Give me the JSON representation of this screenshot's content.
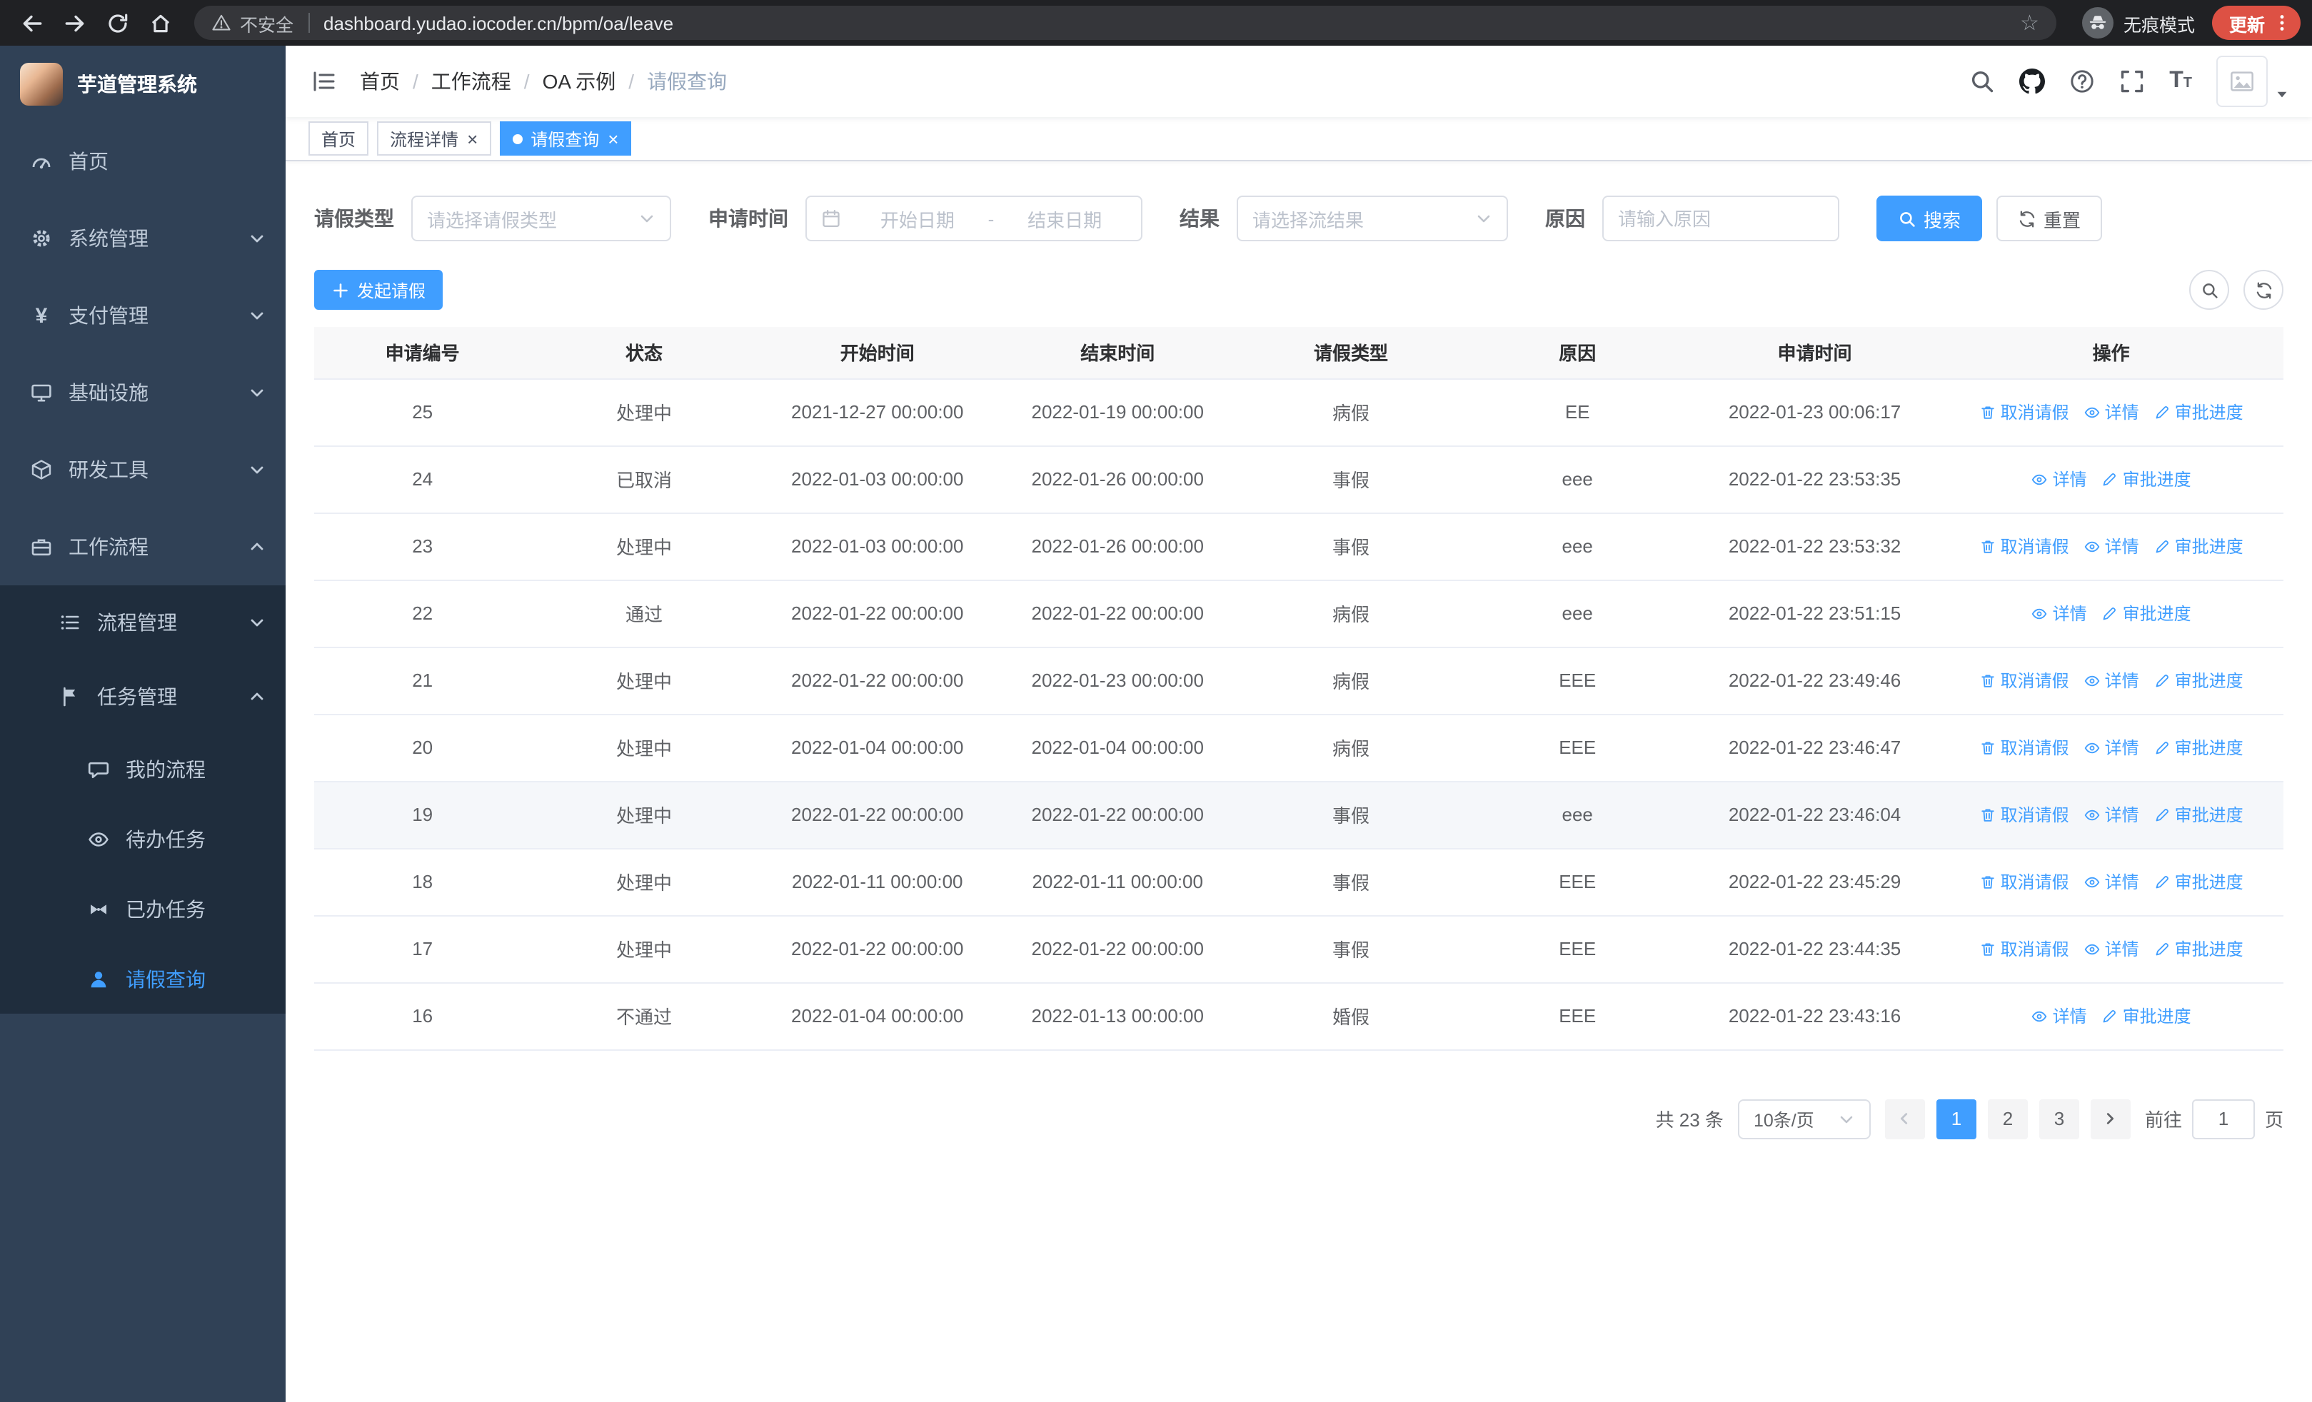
{
  "browser": {
    "security_warning": "不安全",
    "url": "dashboard.yudao.iocoder.cn/bpm/oa/leave",
    "incognito_label": "无痕模式",
    "update_button": "更新"
  },
  "sidebar": {
    "logo_title": "芋道管理系统",
    "top_items": [
      "首页",
      "系统管理",
      "支付管理",
      "基础设施",
      "研发工具",
      "工作流程"
    ],
    "workflow_children": [
      "流程管理",
      "任务管理"
    ],
    "task_children": [
      "我的流程",
      "待办任务",
      "已办任务",
      "请假查询"
    ]
  },
  "header": {
    "breadcrumb": [
      "首页",
      "工作流程",
      "OA 示例",
      "请假查询"
    ],
    "breadcrumb_separator": "/"
  },
  "tabs": {
    "home": "首页",
    "detail": "流程详情",
    "leave": "请假查询"
  },
  "filters": {
    "leave_type_label": "请假类型",
    "leave_type_placeholder": "请选择请假类型",
    "apply_time_label": "申请时间",
    "start_date_placeholder": "开始日期",
    "range_separator": "-",
    "end_date_placeholder": "结束日期",
    "result_label": "结果",
    "result_placeholder": "请选择流结果",
    "reason_label": "原因",
    "reason_placeholder": "请输入原因",
    "search_button": "搜索",
    "reset_button": "重置"
  },
  "toolbar": {
    "create_button": "发起请假"
  },
  "table": {
    "columns": [
      "申请编号",
      "状态",
      "开始时间",
      "结束时间",
      "请假类型",
      "原因",
      "申请时间",
      "操作"
    ],
    "actions": {
      "cancel": "取消请假",
      "detail": "详情",
      "progress": "审批进度"
    },
    "rows": [
      {
        "id": "25",
        "status": "处理中",
        "start": "2021-12-27 00:00:00",
        "end": "2022-01-19 00:00:00",
        "type": "病假",
        "reason": "EE",
        "apply_time": "2022-01-23 00:06:17",
        "cancellable": true,
        "highlighted": false
      },
      {
        "id": "24",
        "status": "已取消",
        "start": "2022-01-03 00:00:00",
        "end": "2022-01-26 00:00:00",
        "type": "事假",
        "reason": "eee",
        "apply_time": "2022-01-22 23:53:35",
        "cancellable": false,
        "highlighted": false
      },
      {
        "id": "23",
        "status": "处理中",
        "start": "2022-01-03 00:00:00",
        "end": "2022-01-26 00:00:00",
        "type": "事假",
        "reason": "eee",
        "apply_time": "2022-01-22 23:53:32",
        "cancellable": true,
        "highlighted": false
      },
      {
        "id": "22",
        "status": "通过",
        "start": "2022-01-22 00:00:00",
        "end": "2022-01-22 00:00:00",
        "type": "病假",
        "reason": "eee",
        "apply_time": "2022-01-22 23:51:15",
        "cancellable": false,
        "highlighted": false
      },
      {
        "id": "21",
        "status": "处理中",
        "start": "2022-01-22 00:00:00",
        "end": "2022-01-23 00:00:00",
        "type": "病假",
        "reason": "EEE",
        "apply_time": "2022-01-22 23:49:46",
        "cancellable": true,
        "highlighted": false
      },
      {
        "id": "20",
        "status": "处理中",
        "start": "2022-01-04 00:00:00",
        "end": "2022-01-04 00:00:00",
        "type": "病假",
        "reason": "EEE",
        "apply_time": "2022-01-22 23:46:47",
        "cancellable": true,
        "highlighted": false
      },
      {
        "id": "19",
        "status": "处理中",
        "start": "2022-01-22 00:00:00",
        "end": "2022-01-22 00:00:00",
        "type": "事假",
        "reason": "eee",
        "apply_time": "2022-01-22 23:46:04",
        "cancellable": true,
        "highlighted": true
      },
      {
        "id": "18",
        "status": "处理中",
        "start": "2022-01-11 00:00:00",
        "end": "2022-01-11 00:00:00",
        "type": "事假",
        "reason": "EEE",
        "apply_time": "2022-01-22 23:45:29",
        "cancellable": true,
        "highlighted": false
      },
      {
        "id": "17",
        "status": "处理中",
        "start": "2022-01-22 00:00:00",
        "end": "2022-01-22 00:00:00",
        "type": "事假",
        "reason": "EEE",
        "apply_time": "2022-01-22 23:44:35",
        "cancellable": true,
        "highlighted": false
      },
      {
        "id": "16",
        "status": "不通过",
        "start": "2022-01-04 00:00:00",
        "end": "2022-01-13 00:00:00",
        "type": "婚假",
        "reason": "EEE",
        "apply_time": "2022-01-22 23:43:16",
        "cancellable": false,
        "highlighted": false
      }
    ]
  },
  "pagination": {
    "total_text": "共 23 条",
    "page_size": "10条/页",
    "pages": [
      "1",
      "2",
      "3"
    ],
    "active_page": "1",
    "goto_label": "前往",
    "goto_value": "1",
    "goto_suffix": "页"
  },
  "colors": {
    "primary": "#409EFF",
    "update_pill": "#dd5144",
    "sidebar_bg": "#304156",
    "submenu_bg": "#1f2d3d"
  }
}
